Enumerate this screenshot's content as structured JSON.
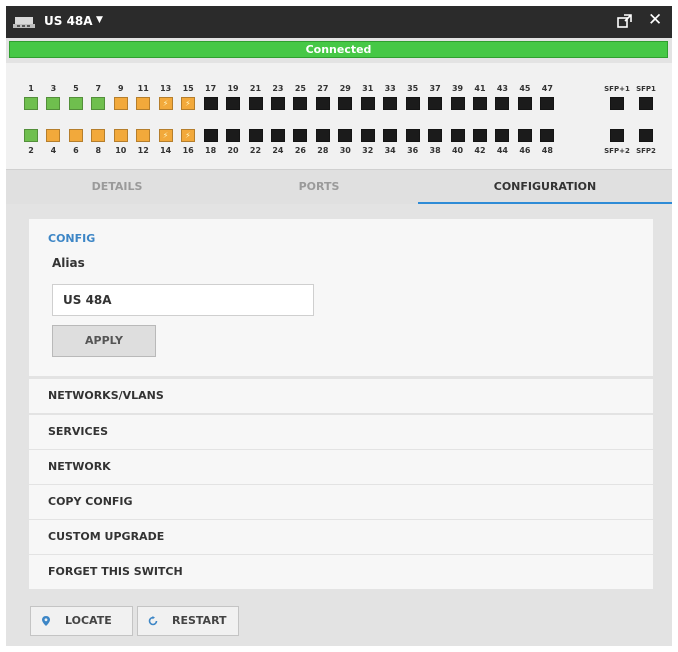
{
  "titlebar": {
    "title": "US 48A"
  },
  "status": {
    "text": "Connected",
    "color": "#46c846"
  },
  "ports": {
    "top_numbers": [
      "1",
      "3",
      "5",
      "7",
      "9",
      "11",
      "13",
      "15",
      "17",
      "19",
      "21",
      "23",
      "25",
      "27",
      "29",
      "31",
      "33",
      "35",
      "37",
      "39",
      "41",
      "43",
      "45",
      "47"
    ],
    "bottom_numbers": [
      "2",
      "4",
      "6",
      "8",
      "10",
      "12",
      "14",
      "16",
      "18",
      "20",
      "22",
      "24",
      "26",
      "28",
      "30",
      "32",
      "34",
      "36",
      "38",
      "40",
      "42",
      "44",
      "46",
      "48"
    ],
    "top_states": [
      "green",
      "green",
      "green",
      "green",
      "orange",
      "orange",
      "orange-poe",
      "orange-poe",
      "off",
      "off",
      "off",
      "off",
      "off",
      "off",
      "off",
      "off",
      "off",
      "off",
      "off",
      "off",
      "off",
      "off",
      "off",
      "off"
    ],
    "bottom_states": [
      "green",
      "orange",
      "orange",
      "orange",
      "orange",
      "orange",
      "orange-poe",
      "orange-poe",
      "off",
      "off",
      "off",
      "off",
      "off",
      "off",
      "off",
      "off",
      "off",
      "off",
      "off",
      "off",
      "off",
      "off",
      "off",
      "off"
    ],
    "sfp_top": [
      "SFP+1",
      "SFP1"
    ],
    "sfp_bottom": [
      "SFP+2",
      "SFP2"
    ],
    "colors": {
      "green": "#6fbf4e",
      "orange": "#f2a93b",
      "off": "#1b1b1b"
    }
  },
  "tabs": [
    {
      "label": "DETAILS",
      "active": false
    },
    {
      "label": "PORTS",
      "active": false
    },
    {
      "label": "CONFIGURATION",
      "active": true
    }
  ],
  "config": {
    "heading": "CONFIG",
    "alias_label": "Alias",
    "alias_value": "US 48A",
    "apply_label": "APPLY"
  },
  "sections": [
    "NETWORKS/VLANS",
    "SERVICES",
    "NETWORK",
    "COPY CONFIG",
    "CUSTOM UPGRADE",
    "FORGET THIS SWITCH"
  ],
  "buttons": {
    "locate": "LOCATE",
    "restart": "RESTART"
  },
  "accent_color": "#3d86c6"
}
